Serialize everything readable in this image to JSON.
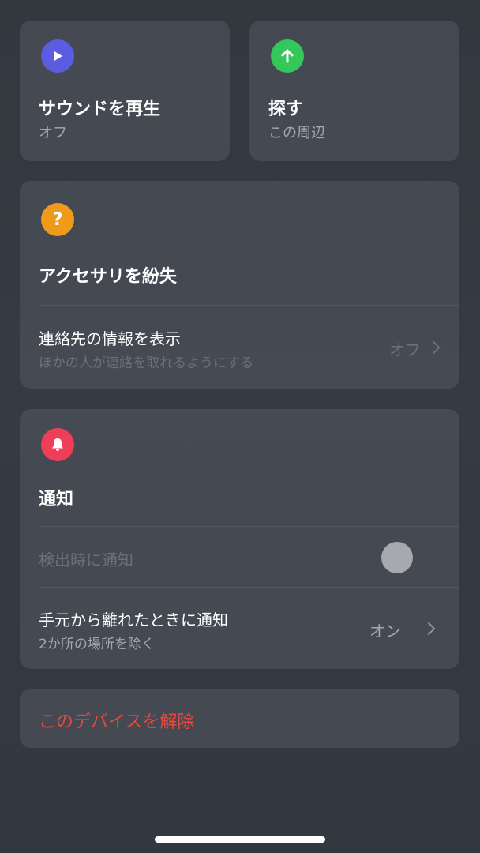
{
  "play_sound": {
    "icon": "play-icon",
    "title": "サウンドを再生",
    "status": "オフ",
    "color": "#5b5ce2"
  },
  "find": {
    "icon": "arrow-up-icon",
    "title": "探す",
    "status": "この周辺",
    "color": "#34c759"
  },
  "lost_accessory": {
    "icon": "question-icon",
    "title": "アクセサリを紛失",
    "color": "#f09a1a",
    "contact_row": {
      "label": "連絡先の情報を表示",
      "description": "ほかの人が連絡を取れるようにする",
      "value": "オフ"
    }
  },
  "notifications": {
    "icon": "bell-icon",
    "title": "通知",
    "color": "#ef3e58",
    "notify_when_found": {
      "label": "検出時に通知",
      "enabled": false
    },
    "notify_when_left_behind": {
      "label": "手元から離れたときに通知",
      "description": "2か所の場所を除く",
      "value": "オン"
    }
  },
  "remove_device": {
    "label": "このデバイスを解除",
    "color": "#e5493f"
  }
}
